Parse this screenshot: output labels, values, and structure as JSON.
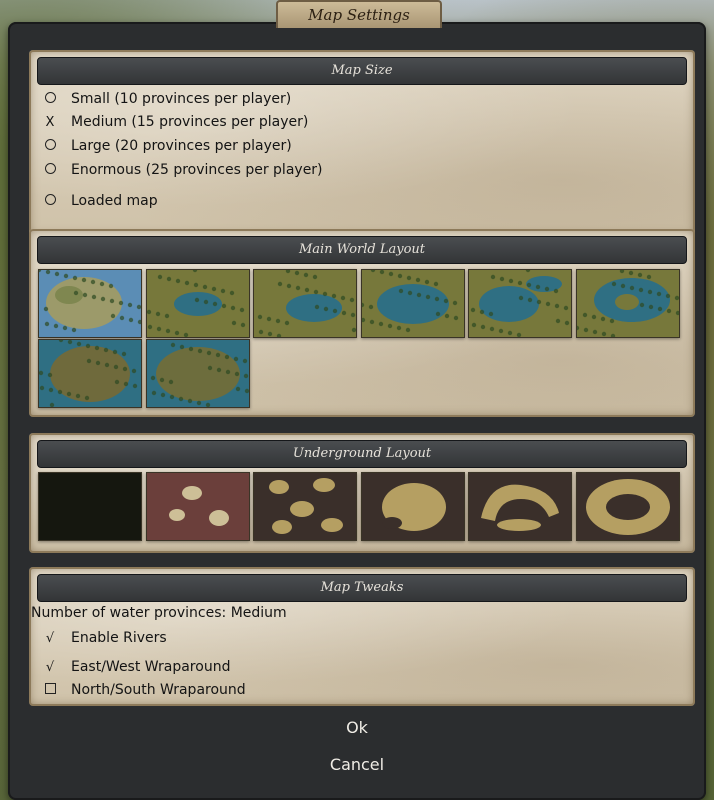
{
  "dialog": {
    "title": "Map Settings"
  },
  "map_size": {
    "header": "Map Size",
    "options": [
      {
        "mark": "○",
        "label": "Small (10 provinces per player)"
      },
      {
        "mark": "X",
        "label": "Medium (15 provinces per player)"
      },
      {
        "mark": "○",
        "label": "Large (20 provinces per player)"
      },
      {
        "mark": "○",
        "label": "Enormous (25 provinces per player)"
      },
      {
        "mark": "○",
        "label": "Loaded map"
      }
    ]
  },
  "world_layout": {
    "header": "Main World Layout",
    "thumbnails": 8
  },
  "underground_layout": {
    "header": "Underground Layout",
    "thumbnails": 6
  },
  "map_tweaks": {
    "header": "Map Tweaks",
    "water_provinces": "Number of water provinces: Medium",
    "options": [
      {
        "mark": "√",
        "label": "Enable Rivers"
      },
      {
        "mark": "√",
        "label": "East/West Wraparound"
      },
      {
        "mark": "□",
        "label": "North/South Wraparound"
      }
    ]
  },
  "buttons": {
    "ok": "Ok",
    "cancel": "Cancel"
  },
  "colors": {
    "panel": "#d8cdb8",
    "header": "#3d4043",
    "water": "#2f6f83",
    "land": "#7c7a3d"
  }
}
